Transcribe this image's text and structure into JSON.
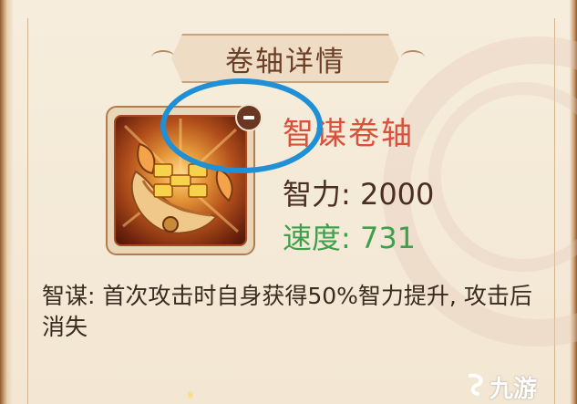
{
  "panel": {
    "title": "卷轴详情"
  },
  "item": {
    "icon": "scroll-icon",
    "badge": "minus-icon",
    "name": "智谋卷轴",
    "stats": [
      {
        "label": "智力",
        "value": "2000",
        "text": "智力: 2000"
      },
      {
        "label": "速度",
        "value": "731",
        "text": "速度: 731"
      }
    ],
    "description": "智谋: 首次攻击时自身获得50%智力提升, 攻击后消失"
  },
  "watermark": {
    "text": "九游",
    "icon": "jiuyou-logo-icon"
  },
  "colors": {
    "item_name": "#d9503b",
    "speed": "#3f9f4d",
    "highlight": "#1f8fd6",
    "title": "#6b3e26"
  }
}
